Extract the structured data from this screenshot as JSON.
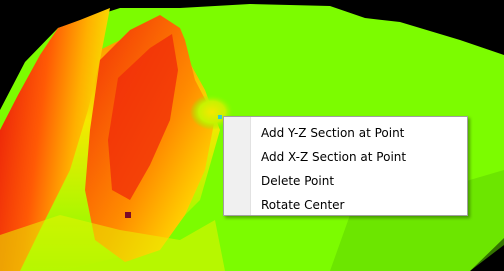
{
  "surface": {
    "colors": {
      "background": "#000000",
      "high": "#e8180a",
      "mid": "#ff7a00",
      "low_mid": "#f5e800",
      "low": "#7cfc00"
    },
    "markers": [
      {
        "name": "selected-point",
        "color": "#33cccc"
      },
      {
        "name": "rotate-center-marker",
        "color": "#7a0a2a"
      }
    ]
  },
  "context_menu": {
    "items": [
      {
        "label": "Add Y-Z Section at Point"
      },
      {
        "label": "Add X-Z Section at Point"
      },
      {
        "label": "Delete Point"
      },
      {
        "label": "Rotate Center"
      }
    ]
  }
}
